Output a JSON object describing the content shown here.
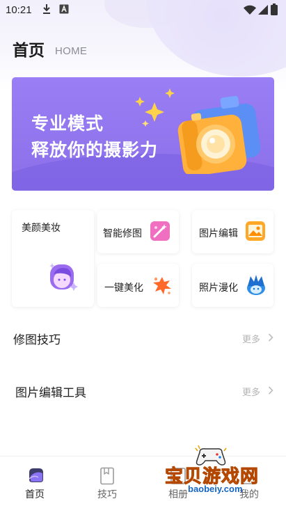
{
  "status_bar": {
    "time": "10:21",
    "left_icons": [
      "download-icon",
      "a-icon"
    ],
    "right_icons": [
      "wifi-icon",
      "signal-icon",
      "battery-icon"
    ]
  },
  "header": {
    "title": "首页",
    "subtitle": "HOME"
  },
  "banner": {
    "line1": "专业模式",
    "line2": "释放你的摄影力",
    "accent_color": "#8d72ef",
    "illustration": "camera-icon"
  },
  "features": {
    "beauty": {
      "label": "美颜美妆",
      "icon": "face-makeup-icon"
    },
    "smart_retouch": {
      "label": "智能修图",
      "icon": "magic-wand-icon"
    },
    "photo_edit": {
      "label": "图片编辑",
      "icon": "image-icon"
    },
    "one_click": {
      "label": "一键美化",
      "icon": "sparkle-splash-icon"
    },
    "cartoon": {
      "label": "照片漫化",
      "icon": "cartoon-icon"
    }
  },
  "sections": [
    {
      "title": "修图技巧",
      "more_label": "更多"
    },
    {
      "title": "图片编辑工具",
      "more_label": "更多"
    }
  ],
  "tabbar": {
    "tabs": [
      {
        "label": "首页",
        "icon": "home-icon",
        "active": true
      },
      {
        "label": "技巧",
        "icon": "bookmark-icon",
        "active": false
      },
      {
        "label": "相册",
        "icon": "album-icon",
        "active": false
      },
      {
        "label": "我的",
        "icon": "profile-icon",
        "active": false
      }
    ],
    "active_color": "#222222",
    "inactive_color": "#888888"
  },
  "watermark": {
    "title": "宝贝游戏网",
    "url": "baobeiy.com"
  }
}
